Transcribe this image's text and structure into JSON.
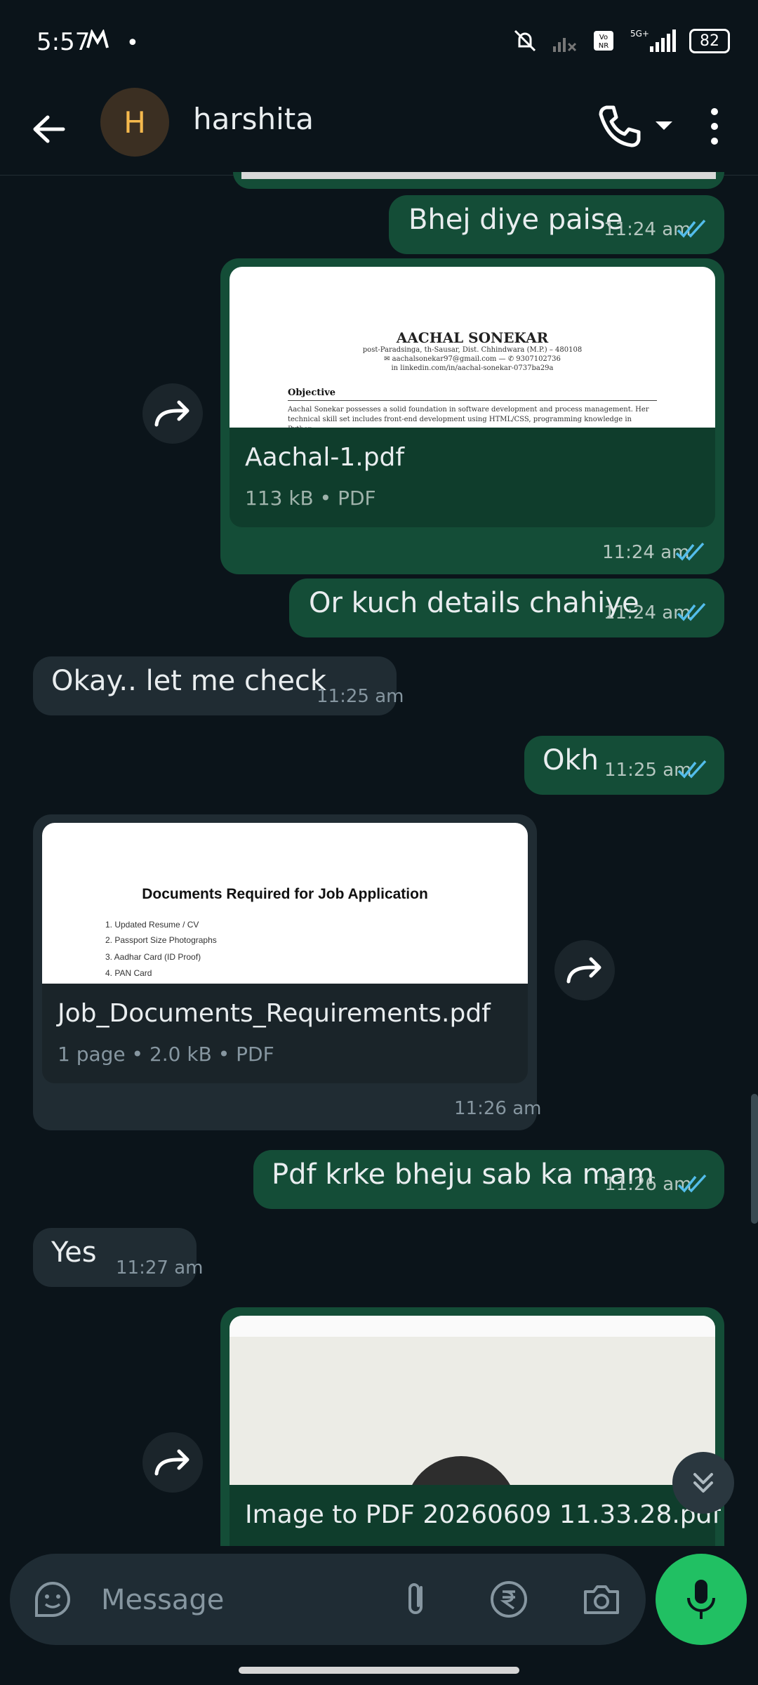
{
  "status_bar": {
    "time": "5:57",
    "carrier_icon": "m-logo",
    "dot": "•",
    "battery": "82"
  },
  "header": {
    "avatar_letter": "H",
    "name": "harshita"
  },
  "messages": {
    "m1": {
      "text": "Bhej diye paise",
      "time": "11:24 am"
    },
    "m2": {
      "file_name": "Aachal-1.pdf",
      "meta": "113 kB • PDF",
      "time": "11:24 am",
      "preview": {
        "name": "AACHAL SONEKAR",
        "address": "post-Paradsinga, th-Sausar, Dist. Chhindwara (M.P.) – 480108",
        "contact": "✉ aachalsonekar97@gmail.com  —  ✆ 9307102736",
        "linkedin": "in linkedin.com/in/aachal-sonekar-0737ba29a",
        "section": "Objective",
        "para": "Aachal Sonekar possesses a solid foundation in software development and process management. Her technical skill set includes front-end development using HTML/CSS, programming knowledge in Python,"
      }
    },
    "m3": {
      "text": "Or kuch details chahiye",
      "time": "11:24 am"
    },
    "m4": {
      "text": "Okay.. let me check",
      "time": "11:25 am"
    },
    "m5": {
      "text": "Okh",
      "time": "11:25 am"
    },
    "m6": {
      "file_name": "Job_Documents_Requirements.pdf",
      "meta": "1 page • 2.0 kB • PDF",
      "time": "11:26 am",
      "preview": {
        "title": "Documents Required for Job Application",
        "items": [
          "1. Updated Resume / CV",
          "2. Passport Size Photographs",
          "3. Aadhar Card (ID Proof)",
          "4. PAN Card"
        ]
      }
    },
    "m7": {
      "text": "Pdf krke bheju sab ka mam",
      "time": "11:26 am"
    },
    "m8": {
      "text": "Yes",
      "time": "11:27 am"
    },
    "m9": {
      "file_name": "Image to PDF 20260609 11.33.28.pdf"
    }
  },
  "composer": {
    "placeholder": "Message"
  },
  "colors": {
    "background": "#0b141a",
    "outgoing": "#144d37",
    "incoming": "#202c33",
    "accent": "#21c063",
    "tick": "#53bdeb"
  }
}
